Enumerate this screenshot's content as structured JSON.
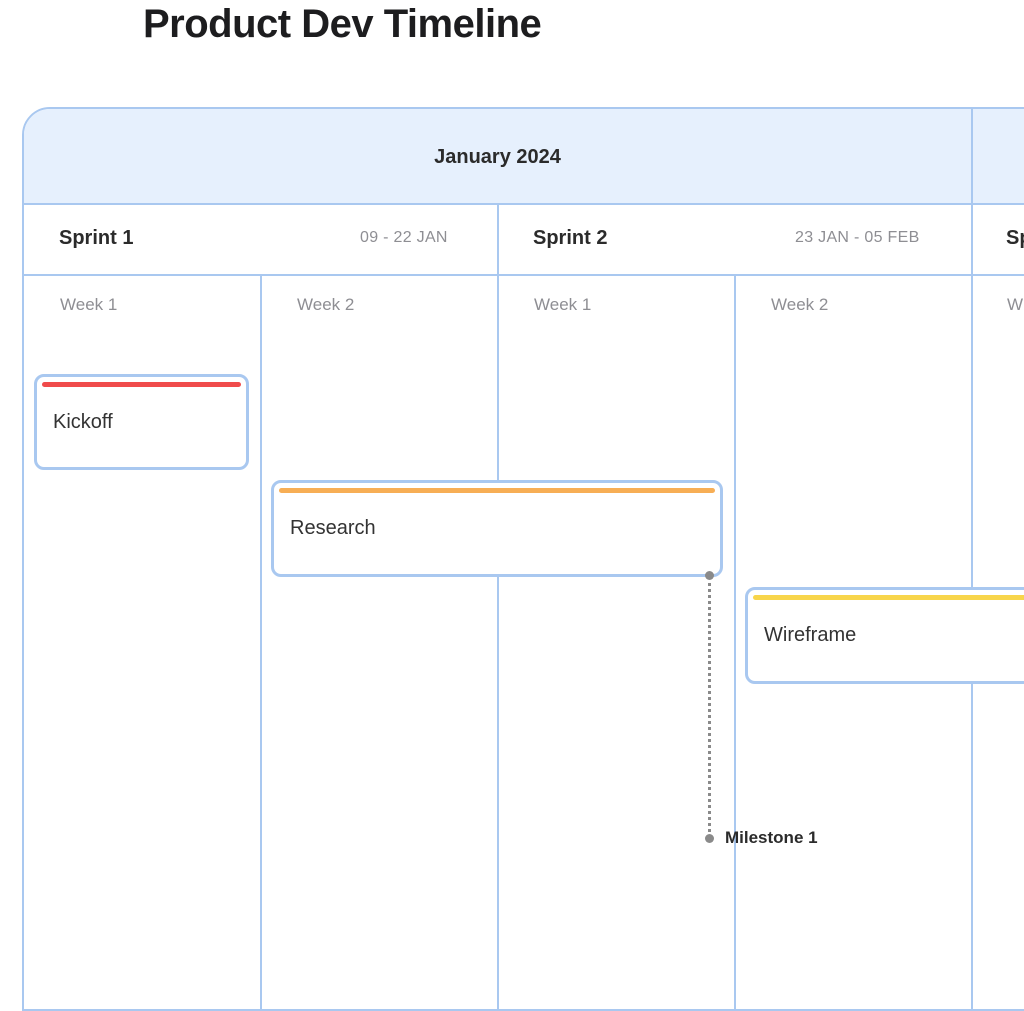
{
  "title": "Product Dev Timeline",
  "month": "January 2024",
  "sprints": [
    {
      "name": "Sprint 1",
      "dates": "09 - 22 JAN"
    },
    {
      "name": "Sprint 2",
      "dates": "23 JAN - 05 FEB"
    },
    {
      "name": "Sp",
      "dates": ""
    }
  ],
  "weeks": [
    "Week 1",
    "Week 2",
    "Week 1",
    "Week 2",
    "W"
  ],
  "tasks": [
    {
      "label": "Kickoff",
      "color": "#f04b4b"
    },
    {
      "label": "Research",
      "color": "#f7ae55"
    },
    {
      "label": "Wireframe",
      "color": "#f8d54a"
    }
  ],
  "milestone": {
    "label": "Milestone 1"
  },
  "colors": {
    "grid": "#a9c8f0",
    "header_bg": "#e6f0fd",
    "connector": "#8a8a8a"
  }
}
